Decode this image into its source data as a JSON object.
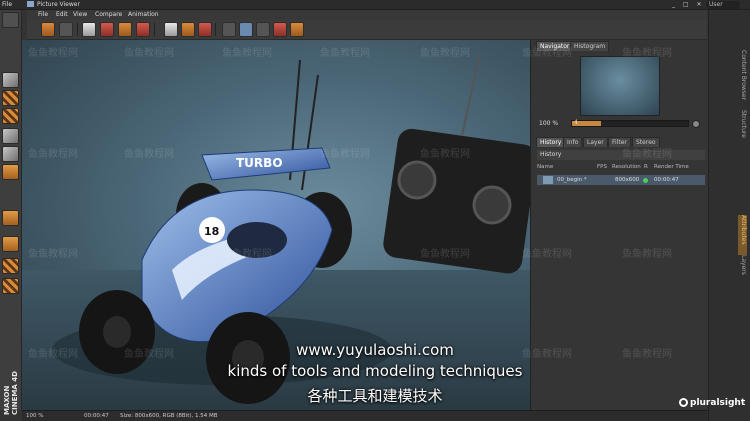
{
  "host": {
    "file_menu": "File",
    "user_tab": "User"
  },
  "window": {
    "title": "Picture Viewer",
    "controls": "_ □ ✕"
  },
  "menu": [
    "File",
    "Edit",
    "View",
    "Compare",
    "Animation"
  ],
  "navigator": {
    "tabs": [
      "Navigator",
      "Histogram"
    ],
    "zoom": "100 %",
    "slider_value": "4",
    "slider_fill": 0.25
  },
  "info_tabs": [
    "History",
    "Info",
    "Layer",
    "Filter",
    "Stereo"
  ],
  "history": {
    "header": "History",
    "columns": [
      "Name",
      "FPS",
      "Resolution",
      "R",
      "Render Time"
    ],
    "row": {
      "name": "00_begin *",
      "resolution": "800x600",
      "render_time": "00:00:47"
    }
  },
  "status": {
    "zoom": "100 %",
    "time": "00:00:47",
    "info": "Size: 800x600, RGB (8Bit), 1.54 MB"
  },
  "car_label": {
    "number": "18",
    "brand": "TURBO"
  },
  "right_strip": [
    "Content Browser",
    "Structure",
    "Attributes",
    "Layers"
  ],
  "overlay": {
    "url": "www.yuyulaoshi.com",
    "subtitle_en": "kinds of tools and modeling techniques",
    "subtitle_zh": "各种工具和建模技术",
    "brand": "pluralsight",
    "watermark": "鱼鱼教程网"
  },
  "maxon_logo": "MAXON CINEMA 4D",
  "colors": {
    "accent": "#c9883f",
    "selected": "#6b8ab0",
    "render_ok": "#4bd05a"
  }
}
